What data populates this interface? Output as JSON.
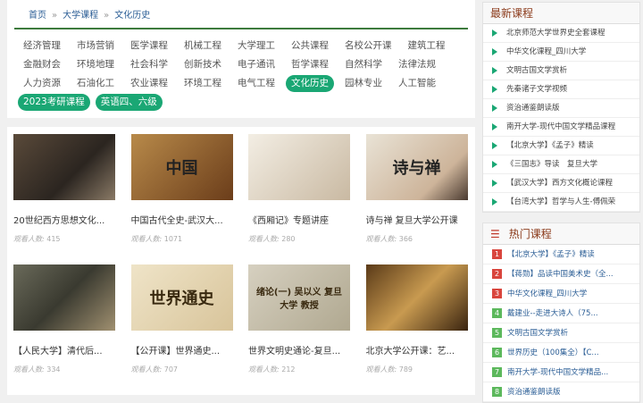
{
  "breadcrumb": [
    "首页",
    "大学课程",
    "文化历史"
  ],
  "breadcrumb_sep": "»",
  "tags": [
    "经济管理",
    "市场营销",
    "医学课程",
    "机械工程",
    "大学理工",
    "公共课程",
    "名校公开课",
    "建筑工程",
    "金融财会",
    "环境地理",
    "社会科学",
    "创新技术",
    "电子通讯",
    "哲学课程",
    "自然科学",
    "法律法规",
    "人力资源",
    "石油化工",
    "农业课程",
    "环境工程",
    "电气工程",
    "文化历史",
    "园林专业",
    "人工智能",
    "2023考研课程",
    "英语四、六级"
  ],
  "active_tags": [
    "文化历史",
    "2023考研课程",
    "英语四、六级"
  ],
  "views_label": "观看人数:",
  "courses": [
    {
      "title": "20世纪西方思想文化...",
      "views": "415",
      "img_text": ""
    },
    {
      "title": "中国古代全史-武汉大...",
      "views": "1071",
      "img_text": "中国"
    },
    {
      "title": "《西厢记》专题讲座",
      "views": "280",
      "img_text": ""
    },
    {
      "title": "诗与禅 复旦大学公开课",
      "views": "366",
      "img_text": "诗与禅"
    },
    {
      "title": "【人民大学】清代后...",
      "views": "334",
      "img_text": ""
    },
    {
      "title": "【公开课】世界通史...",
      "views": "707",
      "img_text": "世界通史"
    },
    {
      "title": "世界文明史通论-复旦...",
      "views": "212",
      "img_text": "绪论(一) 吴以义 复旦大学 教授"
    },
    {
      "title": "北京大学公开课：艺...",
      "views": "789",
      "img_text": ""
    }
  ],
  "latest": {
    "title": "最新课程",
    "items": [
      "北京师范大学世界史全套课程",
      "中华文化课程_四川大学",
      "文明古国文学赏析",
      "先秦诸子文学视频",
      "资治通鉴朗读版",
      "南开大学-现代中国文学精品课程",
      "【北京大学】《孟子》精读",
      "《三国志》导读　复旦大学",
      "【武汉大学】西方文化概论课程",
      "【台湾大学】哲学与人生-傅佩荣"
    ]
  },
  "hot": {
    "title": "热门课程",
    "items": [
      {
        "rank": "1",
        "label": "【北京大学】《孟子》精读"
      },
      {
        "rank": "2",
        "label": "【蒋勋】品读中国美术史（全..."
      },
      {
        "rank": "3",
        "label": "中华文化课程_四川大学"
      },
      {
        "rank": "4",
        "label": "戴建业--走进大诗人（75..."
      },
      {
        "rank": "5",
        "label": "文明古国文学赏析"
      },
      {
        "rank": "6",
        "label": "世界历史（100集全）【C..."
      },
      {
        "rank": "7",
        "label": "南开大学-现代中国文学精品..."
      },
      {
        "rank": "8",
        "label": "资治通鉴朗读版"
      }
    ]
  },
  "colors": {
    "accent": "#1aa774",
    "rank_top": "#d9453d",
    "rank_other": "#5cb85c"
  }
}
